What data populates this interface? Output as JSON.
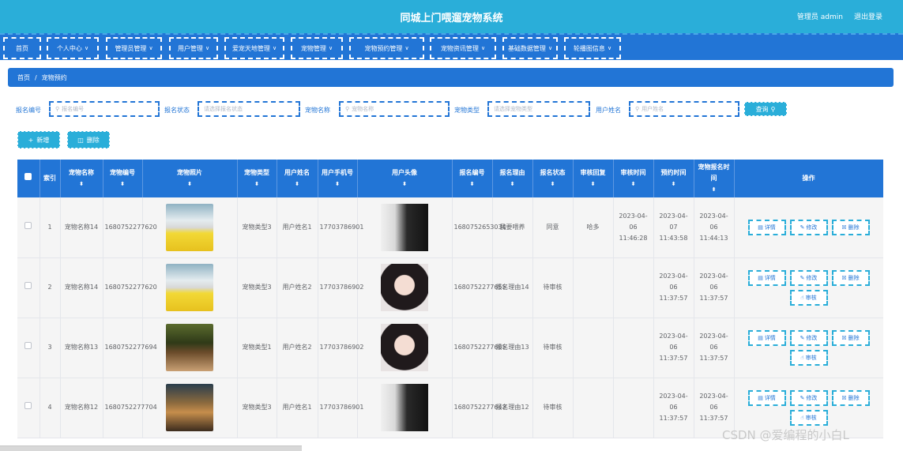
{
  "header": {
    "title": "同城上门喂遛宠物系统",
    "admin": "管理员 admin",
    "logout": "退出登录"
  },
  "nav": [
    {
      "label": "首页",
      "chev": false
    },
    {
      "label": "个人中心",
      "chev": true
    },
    {
      "label": "管理员管理",
      "chev": true
    },
    {
      "label": "用户管理",
      "chev": true
    },
    {
      "label": "爱宠天地管理",
      "chev": true
    },
    {
      "label": "宠物管理",
      "chev": true
    },
    {
      "label": "宠物预约管理",
      "chev": true
    },
    {
      "label": "宠物资讯管理",
      "chev": true
    },
    {
      "label": "基础数据管理",
      "chev": true
    },
    {
      "label": "轮播图信息",
      "chev": true
    }
  ],
  "breadcrumb": {
    "home": "首页",
    "sep": "/",
    "current": "宠物预约"
  },
  "search": {
    "fields": [
      {
        "label": "报名编号",
        "placeholder": "报名编号",
        "icon": true
      },
      {
        "label": "报名状态",
        "placeholder": "请选择报名状态",
        "icon": false
      },
      {
        "label": "宠物名称",
        "placeholder": "宠物名称",
        "icon": true
      },
      {
        "label": "宠物类型",
        "placeholder": "请选择宠物类型",
        "icon": false
      },
      {
        "label": "用户姓名",
        "placeholder": "用户姓名",
        "icon": true
      }
    ],
    "query": "查询"
  },
  "actions": {
    "add": "新增",
    "delete": "删除"
  },
  "table": {
    "headers": [
      "索引",
      "宠物名称",
      "宠物编号",
      "宠物照片",
      "宠物类型",
      "用户姓名",
      "用户手机号",
      "用户头像",
      "报名编号",
      "报名理由",
      "报名状态",
      "审核回复",
      "审核时间",
      "预约时间",
      "宠物报名时间",
      "操作"
    ],
    "rows": [
      {
        "index": "1",
        "pet_name": "宠物名称14",
        "pet_no": "1680752277620",
        "pet_photo": "pet-a",
        "pet_type": "宠物类型3",
        "user_name": "用户姓名1",
        "phone": "17703786901",
        "avatar": "av-a",
        "reg_no": "1680752653034",
        "reason": "我要喂养",
        "status": "同意",
        "reply": "哈多",
        "audit_time": "2023-04-06 11:46:28",
        "appt_time": "2023-04-07 11:43:58",
        "reg_time": "2023-04-06 11:44:13",
        "audit_btn": false
      },
      {
        "index": "2",
        "pet_name": "宠物名称14",
        "pet_no": "1680752277620",
        "pet_photo": "pet-a",
        "pet_type": "宠物类型3",
        "user_name": "用户姓名2",
        "phone": "17703786902",
        "avatar": "av-b",
        "reg_no": "1680752277655",
        "reason": "报名理由14",
        "status": "待审核",
        "reply": "",
        "audit_time": "",
        "appt_time": "2023-04-06 11:37:57",
        "reg_time": "2023-04-06 11:37:57",
        "audit_btn": true
      },
      {
        "index": "3",
        "pet_name": "宠物名称13",
        "pet_no": "1680752277694",
        "pet_photo": "pet-b",
        "pet_type": "宠物类型1",
        "user_name": "用户姓名2",
        "phone": "17703786902",
        "avatar": "av-b",
        "reg_no": "1680752277685",
        "reason": "报名理由13",
        "status": "待审核",
        "reply": "",
        "audit_time": "",
        "appt_time": "2023-04-06 11:37:57",
        "reg_time": "2023-04-06 11:37:57",
        "audit_btn": true
      },
      {
        "index": "4",
        "pet_name": "宠物名称12",
        "pet_no": "1680752277704",
        "pet_photo": "pet-c",
        "pet_type": "宠物类型3",
        "user_name": "用户姓名1",
        "phone": "17703786901",
        "avatar": "av-a",
        "reg_no": "1680752277643",
        "reason": "报名理由12",
        "status": "待审核",
        "reply": "",
        "audit_time": "",
        "appt_time": "2023-04-06 11:37:57",
        "reg_time": "2023-04-06 11:37:57",
        "audit_btn": true
      }
    ],
    "ops": {
      "detail": "详情",
      "edit": "修改",
      "delete": "删除",
      "audit": "审核"
    }
  },
  "watermark": "CSDN @爱编程的小白L",
  "colors": {
    "header": "#2aaed9",
    "nav": "#2275d6",
    "accent": "#2aaed9"
  }
}
